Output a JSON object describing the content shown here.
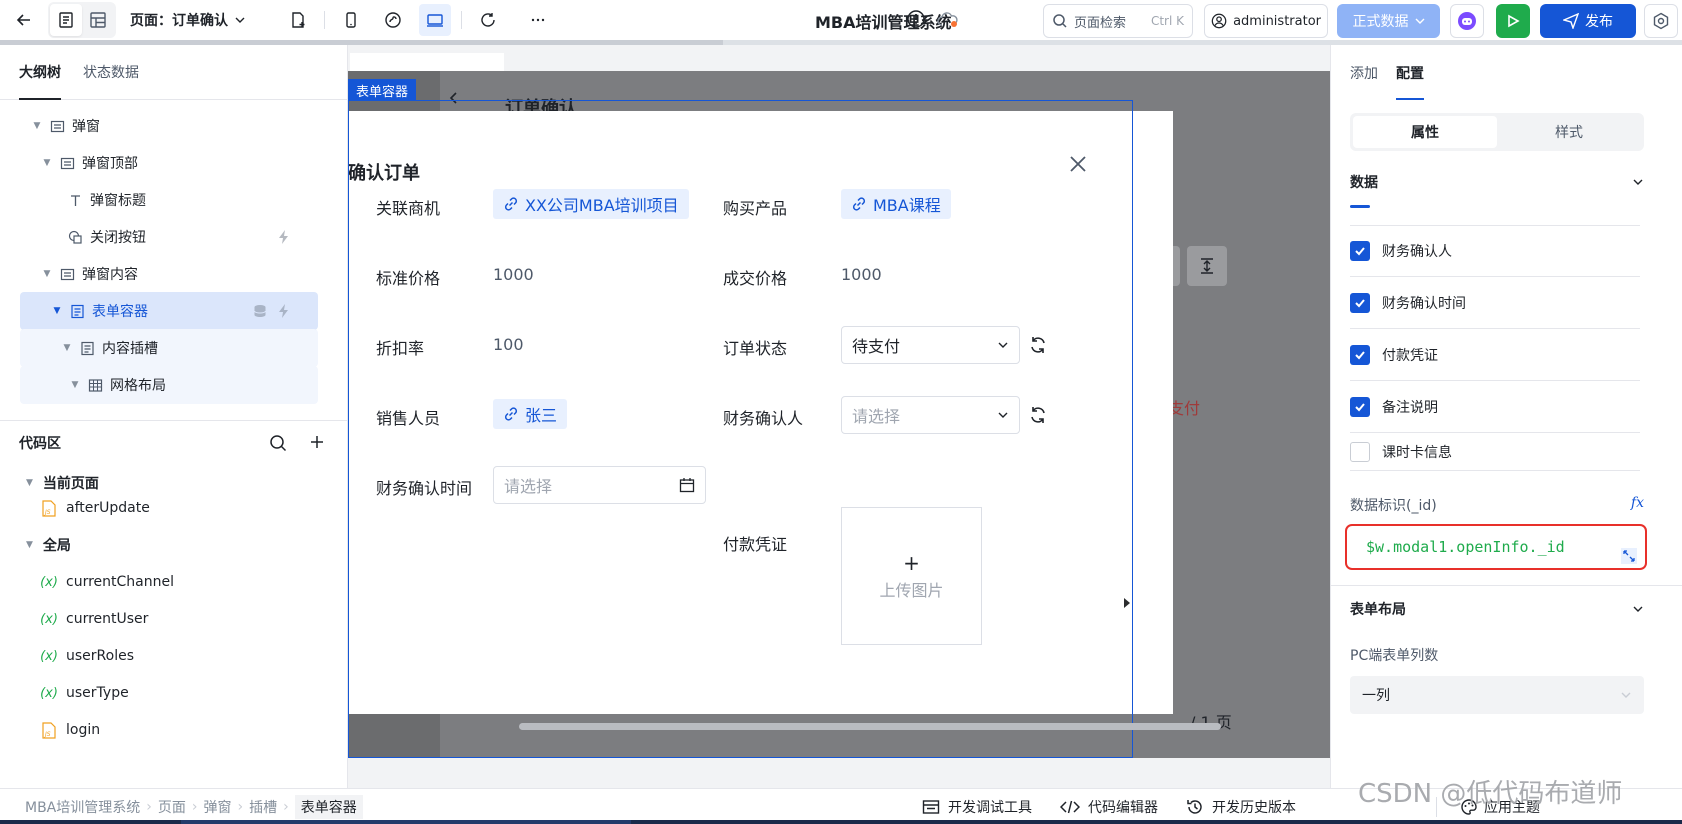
{
  "toolbar": {
    "page_prefix": "页面：",
    "page_name": "订单确认",
    "app_title": "MBA培训管理系统",
    "search_placeholder": "页面检索",
    "search_shortcut": "Ctrl K",
    "user": "administrator",
    "data_mode": "正式数据",
    "publish_label": "发布",
    "progress_fraction": 0.43
  },
  "left": {
    "tabs": [
      "大纲树",
      "状态数据"
    ],
    "tree": [
      {
        "label": "弹窗",
        "icon": "container-icon"
      },
      {
        "label": "弹窗顶部",
        "icon": "container-icon"
      },
      {
        "label": "弹窗标题",
        "icon": "text-icon"
      },
      {
        "label": "关闭按钮",
        "icon": "button-icon"
      },
      {
        "label": "弹窗内容",
        "icon": "container-icon"
      },
      {
        "label": "表单容器",
        "icon": "form-icon"
      },
      {
        "label": "内容插槽",
        "icon": "slot-icon"
      },
      {
        "label": "网格布局",
        "icon": "grid-icon"
      }
    ],
    "code_title": "代码区",
    "code_groups": [
      {
        "label": "当前页面",
        "items": [
          "afterUpdate"
        ]
      },
      {
        "label": "全局",
        "items": [
          "currentChannel",
          "currentUser",
          "userRoles",
          "userType",
          "login"
        ]
      }
    ]
  },
  "canvas": {
    "form_tag": "表单容器",
    "bg_title": "订单确认",
    "bg_status": "支付",
    "bg_page": "/ 1 页",
    "modal_title": "确认订单",
    "fields": {
      "opportunity_label": "关联商机",
      "opportunity_value": "XX公司MBA培训项目",
      "product_label": "购买产品",
      "product_value": "MBA课程",
      "std_price_label": "标准价格",
      "std_price_value": "1000",
      "deal_price_label": "成交价格",
      "deal_price_value": "1000",
      "discount_label": "折扣率",
      "discount_value": "100",
      "status_label": "订单状态",
      "status_value": "待支付",
      "sales_label": "销售人员",
      "sales_value": "张三",
      "finance_label": "财务确认人",
      "finance_placeholder": "请选择",
      "finance_time_label": "财务确认时间",
      "finance_time_placeholder": "请选择",
      "payment_label": "付款凭证",
      "upload_plus": "+",
      "upload_label": "上传图片"
    }
  },
  "right": {
    "tabs": [
      "添加",
      "配置"
    ],
    "segments": [
      "属性",
      "样式"
    ],
    "data_section": "数据",
    "checks": [
      {
        "label": "财务确认人",
        "checked": true
      },
      {
        "label": "财务确认时间",
        "checked": true
      },
      {
        "label": "付款凭证",
        "checked": true
      },
      {
        "label": "备注说明",
        "checked": true
      },
      {
        "label": "课时卡信息",
        "checked": false
      }
    ],
    "id_label": "数据标识(_id)",
    "fx": "fx",
    "id_value": "$w.modal1.openInfo._id",
    "layout_section": "表单布局",
    "pc_cols_label": "PC端表单列数",
    "pc_cols_value": "一列"
  },
  "bottom": {
    "crumbs": [
      "MBA培训管理系统",
      "页面",
      "弹窗",
      "插槽",
      "表单容器"
    ],
    "tools": [
      "开发调试工具",
      "代码编辑器",
      "开发历史版本"
    ],
    "theme": "应用主题"
  },
  "watermark": "CSDN @低代码布道师",
  "colors": {
    "primary": "#1556d6",
    "success": "#1fab4c",
    "highlight": "#e8302a"
  }
}
